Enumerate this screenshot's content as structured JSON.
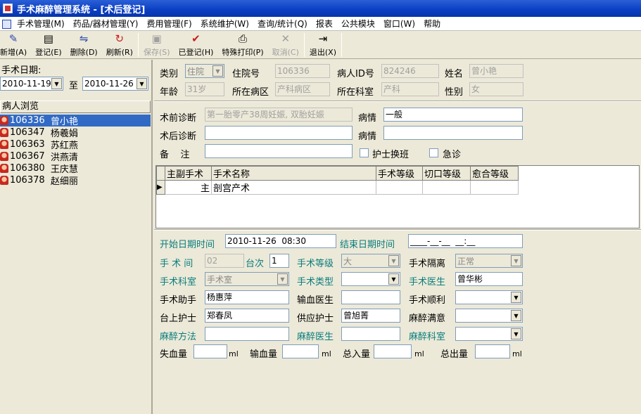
{
  "window": {
    "title": "手术麻醉管理系统 - [术后登记]"
  },
  "menu": [
    "手术管理(M)",
    "药品/器材管理(Y)",
    "费用管理(F)",
    "系统维护(W)",
    "查询/统计(Q)",
    "报表",
    "公共模块",
    "窗口(W)",
    "帮助"
  ],
  "toolbar": {
    "new": "新增(A)",
    "register": "登记(E)",
    "delete": "删除(D)",
    "refresh": "刷新(R)",
    "save": "保存(S)",
    "registered": "已登记(H)",
    "special_print": "特殊打印(P)",
    "cancel": "取消(C)",
    "exit": "退出(X)"
  },
  "left": {
    "date_label": "手术日期:",
    "date_from": "2010-11-19",
    "to_label": "至",
    "date_to": "2010-11-26",
    "browse_label": "病人浏览",
    "patients": [
      {
        "id": "106336",
        "name": "曾小艳"
      },
      {
        "id": "106347",
        "name": "杨羲娟"
      },
      {
        "id": "106363",
        "name": "苏红燕"
      },
      {
        "id": "106367",
        "name": "洪燕清"
      },
      {
        "id": "106380",
        "name": "王庆慧"
      },
      {
        "id": "106378",
        "name": "赵细丽"
      }
    ]
  },
  "info": {
    "type_label": "类别",
    "type_value": "住院",
    "admission_label": "住院号",
    "admission_value": "106336",
    "pid_label": "病人ID号",
    "pid_value": "824246",
    "name_label": "姓名",
    "name_value": "曾小艳",
    "age_label": "年龄",
    "age_value": "31岁",
    "ward_label": "所在病区",
    "ward_value": "产科病区",
    "dept_label": "所在科室",
    "dept_value": "产科",
    "sex_label": "性别",
    "sex_value": "女"
  },
  "diag": {
    "pre_label": "术前诊断",
    "pre_value": "第一胎零产38周妊娠, 双胎妊娠",
    "cond_label": "病情",
    "cond_value": "一般",
    "post_label": "术后诊断",
    "post_value": "",
    "cond2_label": "病情",
    "cond2_value": "",
    "remark_label": "备    注",
    "remark_value": "",
    "nurse_shift": "护士换班",
    "emergency": "急诊"
  },
  "grid": {
    "headers": [
      "主副手术",
      "手术名称",
      "手术等级",
      "切口等级",
      "愈合等级"
    ],
    "rows": [
      [
        "主",
        "剖宫产术",
        "",
        "",
        ""
      ]
    ]
  },
  "op": {
    "start_label": "开始日期时间",
    "start_value": "2010-11-26  08:30",
    "end_label": "结束日期时间",
    "end_value": "____-__-__  __:__",
    "room_label": "手 术 间",
    "room_value": "02",
    "seq_label": "台次",
    "seq_value": "1",
    "level_label": "手术等级",
    "level_value": "大",
    "isolation_label": "手术隔离",
    "isolation_value": "正常",
    "opdept_label": "手术科室",
    "opdept_value": "手术室",
    "optype_label": "手术类型",
    "optype_value": "",
    "surgeon_label": "手术医生",
    "surgeon_value": "曾华彬",
    "assistant_label": "手术助手",
    "assistant_value": "杨惠萍",
    "transfusion_doc_label": "输血医生",
    "transfusion_doc_value": "",
    "smooth_label": "手术顺利",
    "smooth_value": "",
    "scrub_label": "台上护士",
    "scrub_value": "郑春凤",
    "supply_label": "供应护士",
    "supply_value": "曾旭菁",
    "anes_sat_label": "麻醉满意",
    "anes_sat_value": "",
    "anes_method_label": "麻醉方法",
    "anes_method_value": "",
    "anes_doc_label": "麻醉医生",
    "anes_doc_value": "",
    "anes_dept_label": "麻醉科室",
    "anes_dept_value": "",
    "blood_loss_label": "失血量",
    "blood_in_label": "输血量",
    "total_in_label": "总入量",
    "total_out_label": "总出量",
    "unit": "ml"
  }
}
